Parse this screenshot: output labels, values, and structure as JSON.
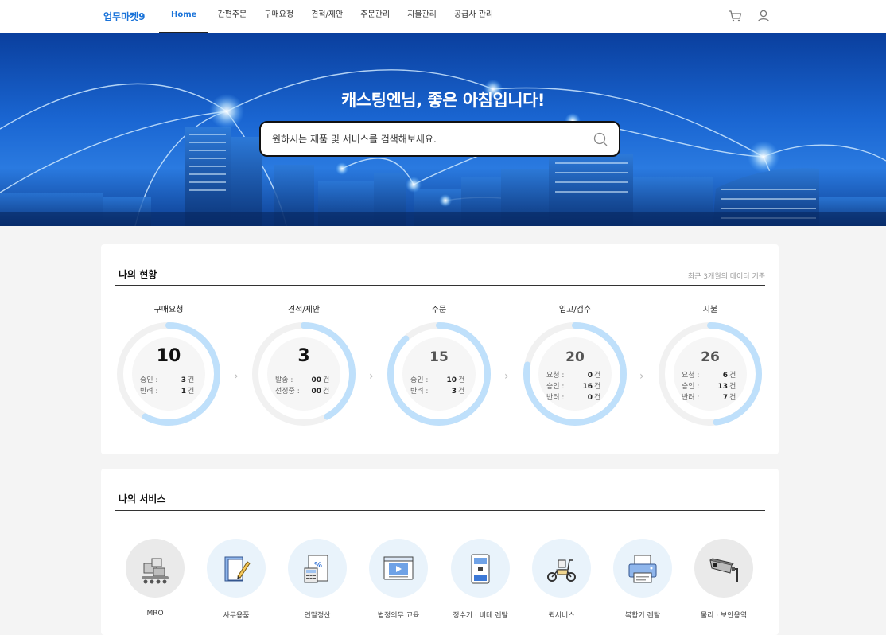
{
  "header": {
    "logo": "업무마켓9",
    "nav": [
      "Home",
      "간편주문",
      "구매요청",
      "견적/제안",
      "주문관리",
      "지불관리",
      "공급사 관리"
    ],
    "icons": [
      "cart-icon",
      "user-icon"
    ]
  },
  "hero": {
    "greeting": "캐스팅엔님, 좋은 아침입니다!",
    "search_placeholder": "원하시는 제품 및 서비스를 검색해보세요."
  },
  "status": {
    "title": "나의 현황",
    "note": "최근 3개월의 데이터 기준",
    "items": [
      {
        "label": "구매요청",
        "total": "10",
        "progress": 0.58,
        "lines": [
          {
            "k": "승인 :",
            "v": "3",
            "u": "건"
          },
          {
            "k": "반려 :",
            "v": "1",
            "u": "건"
          }
        ]
      },
      {
        "label": "견적/제안",
        "total": "3",
        "progress": 0.42,
        "lines": [
          {
            "k": "발송 :",
            "v": "00",
            "u": "건"
          },
          {
            "k": "선정중 :",
            "v": "00",
            "u": "건"
          }
        ]
      },
      {
        "label": "주문",
        "total": "15",
        "progress": 0.88,
        "lines": [
          {
            "k": "승인 :",
            "v": "10",
            "u": "건"
          },
          {
            "k": "반려 :",
            "v": "3",
            "u": "건"
          }
        ]
      },
      {
        "label": "입고/검수",
        "total": "20",
        "progress": 0.78,
        "lines": [
          {
            "k": "요청 :",
            "v": "0",
            "u": "건"
          },
          {
            "k": "승인 :",
            "v": "16",
            "u": "건"
          },
          {
            "k": "반려 :",
            "v": "0",
            "u": "건"
          }
        ]
      },
      {
        "label": "지불",
        "total": "26",
        "progress": 0.48,
        "lines": [
          {
            "k": "요청 :",
            "v": "6",
            "u": "건"
          },
          {
            "k": "승인 :",
            "v": "13",
            "u": "건"
          },
          {
            "k": "반려 :",
            "v": "7",
            "u": "건"
          }
        ]
      }
    ]
  },
  "services": {
    "title": "나의 서비스",
    "items": [
      {
        "label": "MRO",
        "icon": "conveyor-boxes-icon",
        "tone": "gray"
      },
      {
        "label": "사무용품",
        "icon": "notebook-pencil-icon",
        "tone": "blue"
      },
      {
        "label": "연말정산",
        "icon": "tax-document-icon",
        "tone": "blue"
      },
      {
        "label": "법정의무 교육",
        "icon": "video-player-icon",
        "tone": "blue"
      },
      {
        "label": "정수기 · 비데 렌탈",
        "icon": "water-purifier-icon",
        "tone": "blue"
      },
      {
        "label": "퀵서비스",
        "icon": "scooter-icon",
        "tone": "blue"
      },
      {
        "label": "복합기 렌탈",
        "icon": "printer-icon",
        "tone": "blue"
      },
      {
        "label": "물리 · 보안용역",
        "icon": "cctv-camera-icon",
        "tone": "gray"
      }
    ]
  },
  "colors": {
    "accent": "#1a73d9",
    "ring": "#bfe0fb",
    "ring_track": "#f1f1f1"
  }
}
